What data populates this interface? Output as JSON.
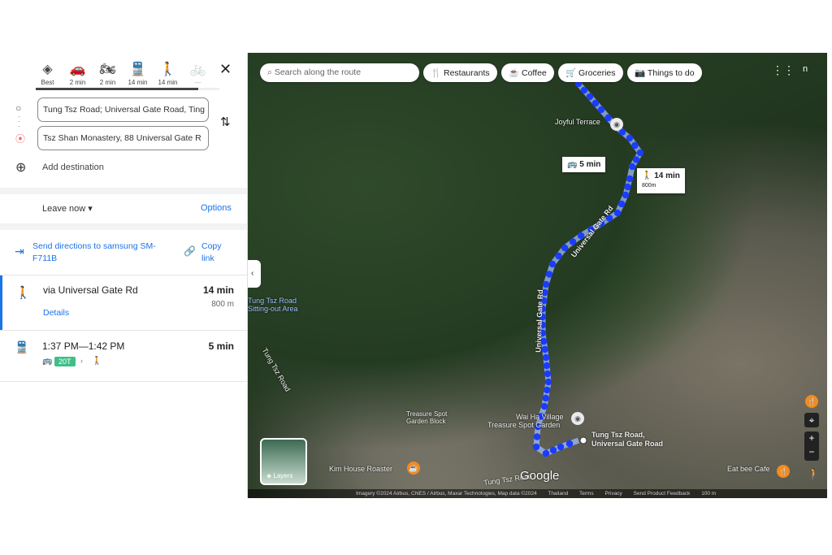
{
  "modes": [
    {
      "icon": "best-route-icon",
      "glyph": "◈",
      "label": "Best"
    },
    {
      "icon": "car-icon",
      "glyph": "🚗",
      "label": "2 min"
    },
    {
      "icon": "motorcycle-icon",
      "glyph": "🏍",
      "label": "2 min"
    },
    {
      "icon": "transit-icon",
      "glyph": "🚆",
      "label": "14 min",
      "selected": true
    },
    {
      "icon": "walk-icon",
      "glyph": "🚶",
      "label": "14 min"
    },
    {
      "icon": "bicycle-icon",
      "glyph": "🚲",
      "label": "—"
    }
  ],
  "origin": "Tung Tsz Road; Universal Gate Road, Ting",
  "destination": "Tsz Shan Monastery, 88 Universal Gate R",
  "add_destination": "Add destination",
  "leave_now": "Leave now",
  "options": "Options",
  "send_directions": "Send directions to samsung SM-F711B",
  "copy_link": "Copy link",
  "routes": [
    {
      "icon": "walk-icon",
      "title": "via Universal Gate Rd",
      "details": "Details",
      "duration": "14 min",
      "distance": "800 m"
    },
    {
      "icon": "transit-icon",
      "title": "1:37 PM—1:42 PM",
      "duration": "5 min",
      "bus": "20T"
    }
  ],
  "map": {
    "search_placeholder": "Search along the route",
    "chips": [
      "Restaurants",
      "Coffee",
      "Groceries",
      "Things to do"
    ],
    "labels": {
      "joyful": "Joyful Terrace",
      "sitting": "Tung Tsz Road Sitting-out Area",
      "waiha": "Wai Ha Village",
      "treasure": "Treasure Spot Garden",
      "treasure2": "Treasure Spot Garden Block",
      "kim": "Kim House Roaster",
      "tungtsz": "Tung Tsz Road",
      "tungtsz2": "Tung Tsz Road",
      "dest": "Tung Tsz Road, Universal Gate Road",
      "ugr1": "Universal Gate Rd",
      "ugr2": "Universal Gate Rd",
      "eatbee": "Eat bee Cafe",
      "n": "n"
    },
    "bubble_transit": "5 min",
    "bubble_walk": "14 min",
    "bubble_walk_dist": "800m",
    "layers": "Layers",
    "google": "Google",
    "footer": [
      "Imagery ©2024 Airbus, CNES / Airbus, Maxar Technologies, Map data ©2024",
      "Thailand",
      "Terms",
      "Privacy",
      "Send Product Feedback",
      "100 m"
    ],
    "route_color": "#1a3cff"
  }
}
